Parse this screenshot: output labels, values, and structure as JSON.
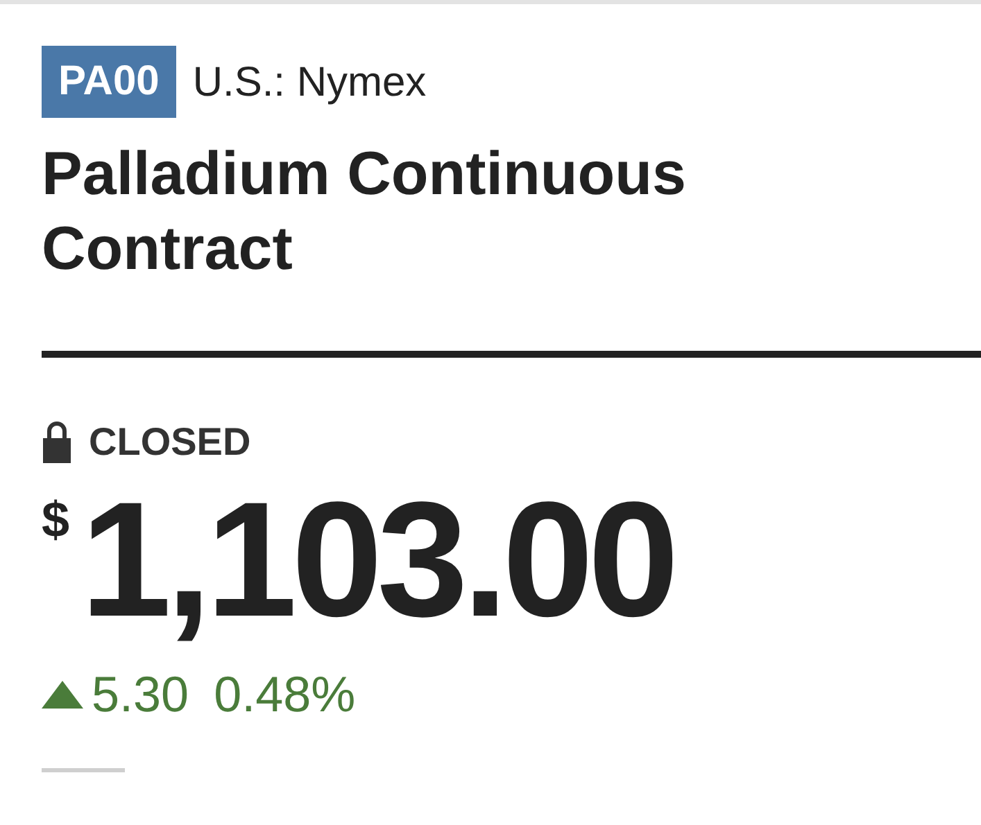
{
  "ticker": {
    "symbol": "PA00",
    "exchange": "U.S.: Nymex"
  },
  "title": "Palladium Continuous Contract",
  "market_status": {
    "label": "CLOSED",
    "kind": "closed"
  },
  "quote": {
    "currency": "$",
    "price": "1,103.00"
  },
  "change": {
    "kind": "up",
    "amount": "5.30",
    "percent": "0.48%"
  }
}
